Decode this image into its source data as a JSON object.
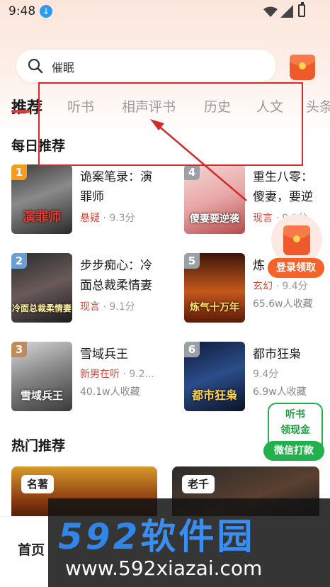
{
  "status_bar": {
    "time": "9:48"
  },
  "search": {
    "query": "催眠"
  },
  "tabs": [
    {
      "label": "推荐",
      "active": true
    },
    {
      "label": "听书"
    },
    {
      "label": "相声评书"
    },
    {
      "label": "历史"
    },
    {
      "label": "人文"
    },
    {
      "label": "头条"
    }
  ],
  "daily": {
    "title": "每日推荐",
    "books": [
      {
        "rank": "1",
        "title": "诡案笔录：演罪师",
        "category": "悬疑",
        "score": "· 9.3分",
        "cover_text": "演罪师"
      },
      {
        "rank": "2",
        "title": "步步痴心：冷面总裁柔情妻",
        "category": "现言",
        "score": "· 9.1分",
        "cover_text": "冷面总裁柔情妻"
      },
      {
        "rank": "3",
        "title": "雪域兵王",
        "category": "新男在听",
        "score": "· 9.2...",
        "extra": "40.1w人收藏",
        "cover_text": "雪域兵王"
      },
      {
        "rank": "4",
        "title": "重生八零：傻妻，要逆袭",
        "category": "现言",
        "score": "· 9.3分",
        "cover_text": "傻妻要逆袭"
      },
      {
        "rank": "5",
        "title": "炼气十万年",
        "category": "玄幻",
        "score": "· 9.4分",
        "extra": "65.6w人收藏",
        "cover_text": "炼气十万年"
      },
      {
        "rank": "6",
        "title": "都市狂枭",
        "category": "",
        "score": "9.4分",
        "extra": "6.9w人收藏",
        "cover_text": "都市狂枭"
      }
    ]
  },
  "floating": {
    "login_label": "登录领取",
    "listen_line1": "听书",
    "listen_line2": "领现金",
    "wechat_label": "微信打款"
  },
  "hot": {
    "title": "热门推荐",
    "cards": [
      {
        "tag": "名著"
      },
      {
        "tag": "老千"
      }
    ]
  },
  "bottom_nav": {
    "home": "首页"
  },
  "watermark": {
    "big": "592",
    "cn": "软件园",
    "url": "www.592xiazai.com"
  },
  "colors": {
    "accent": "#e53935",
    "annotation": "#d42a2a",
    "green": "#23b14d",
    "orange": "#f5622a"
  }
}
